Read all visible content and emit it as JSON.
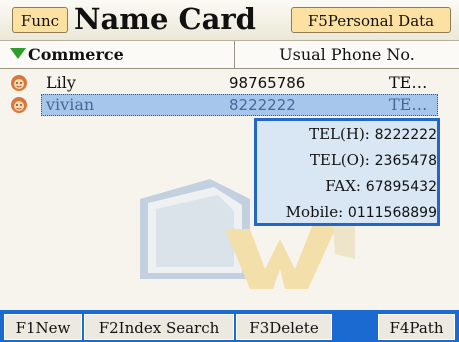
{
  "header": {
    "func_label": "Func",
    "title": "Name Card",
    "personal_label": "F5Personal Data"
  },
  "subbar": {
    "category": "Commerce",
    "column_header": "Usual Phone No."
  },
  "list": [
    {
      "name": "Lily",
      "phone": "98765786",
      "type": "TE…",
      "selected": false
    },
    {
      "name": "vivian",
      "phone": "8222222",
      "type": "TE…",
      "selected": true
    }
  ],
  "popup": {
    "lines": [
      {
        "label": "TEL(H):",
        "value": "8222222"
      },
      {
        "label": "TEL(O):",
        "value": "2365478"
      },
      {
        "label": "FAX:",
        "value": "67895432"
      },
      {
        "label": "Mobile:",
        "value": "0111568899"
      }
    ]
  },
  "footer": {
    "buttons": [
      "F1New",
      "F2Index Search",
      "F3Delete",
      "F4Path"
    ]
  },
  "colors": {
    "footer_bg": "#1a6ad2",
    "selection": "#a7c6ec",
    "popup_border": "#2466c6",
    "button_bg": "#fde1a3",
    "category_marker": "#2e9d2a"
  }
}
